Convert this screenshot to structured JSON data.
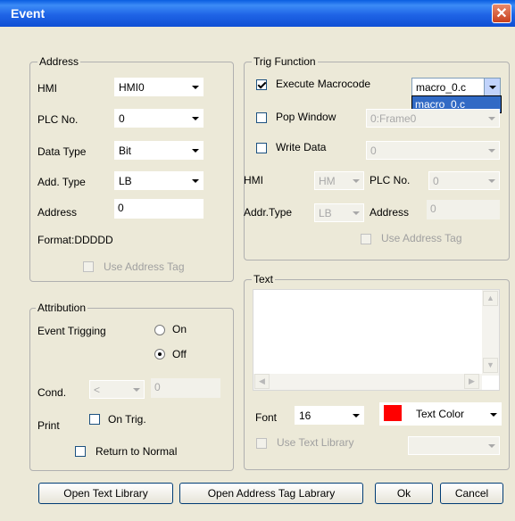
{
  "window": {
    "title": "Event"
  },
  "address": {
    "legend": "Address",
    "hmi_label": "HMI",
    "hmi_value": "HMI0",
    "plc_label": "PLC No.",
    "plc_value": "0",
    "datatype_label": "Data Type",
    "datatype_value": "Bit",
    "addtype_label": "Add. Type",
    "addtype_value": "LB",
    "address_label": "Address",
    "address_value": "0",
    "format_label": "Format:DDDDD",
    "use_tag_label": "Use Address Tag"
  },
  "attribution": {
    "legend": "Attribution",
    "event_trig_label": "Event Trigging",
    "on_label": "On",
    "off_label": "Off",
    "cond_label": "Cond.",
    "cond_value": "<",
    "cond_text": "0",
    "print_label": "Print",
    "on_trig_label": "On Trig.",
    "return_normal_label": "Return to Normal"
  },
  "trig": {
    "legend": "Trig Function",
    "exec_label": "Execute Macrocode",
    "exec_value": "macro_0.c",
    "exec_option": "macro_0.c",
    "popup_label": "Pop Window",
    "popup_value": "0:Frame0",
    "write_label": "Write Data",
    "write_value": "0",
    "hmi_label": "HMI",
    "hmi_value": "HM",
    "plc_label": "PLC No.",
    "plc_value": "0",
    "addrtype_label": "Addr.Type",
    "addrtype_value": "LB",
    "address_label": "Address",
    "address_value": "0",
    "use_tag_label": "Use Address Tag"
  },
  "text": {
    "legend": "Text",
    "font_label": "Font",
    "font_value": "16",
    "color_label": "Text Color",
    "use_lib_label": "Use Text Library",
    "text_color": "#FF0000"
  },
  "buttons": {
    "open_lib": "Open Text Library",
    "open_tag": "Open Address Tag Labrary",
    "ok": "Ok",
    "cancel": "Cancel"
  }
}
